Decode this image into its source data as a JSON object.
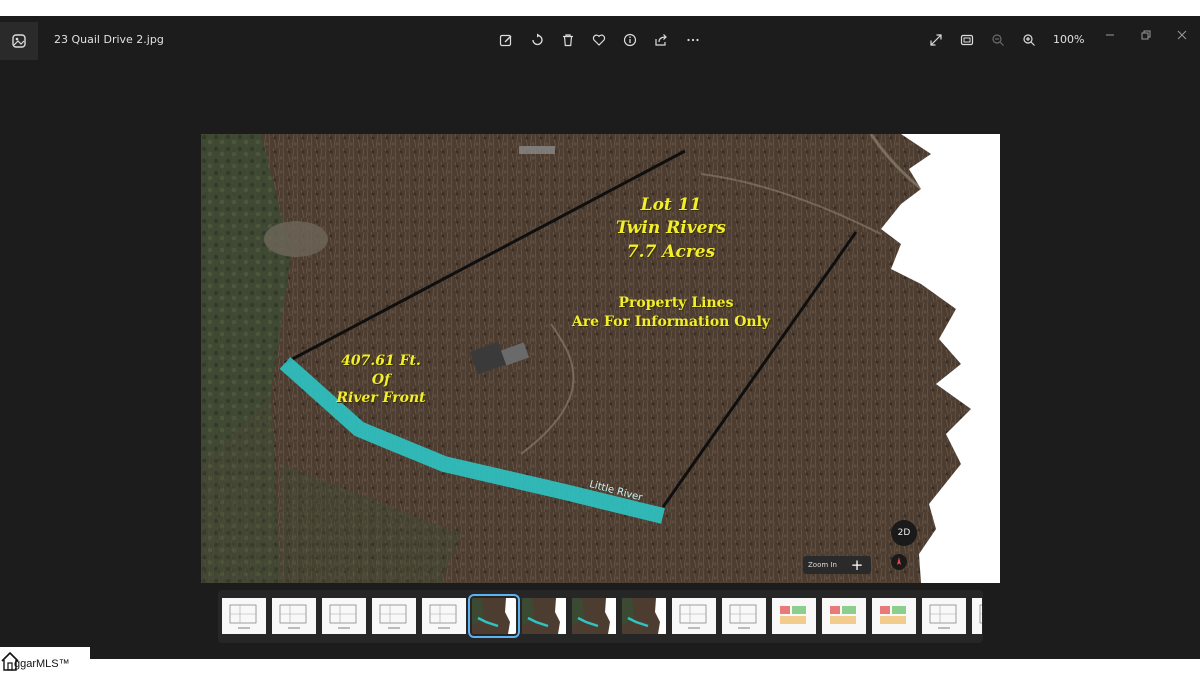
{
  "window": {
    "filename": "23 Quail Drive 2.jpg",
    "zoom_label": "100%"
  },
  "toolbar": {
    "icons": [
      "edit-icon",
      "rotate-icon",
      "delete-icon",
      "favorite-icon",
      "info-icon",
      "share-icon",
      "more-icon"
    ],
    "right_icons": [
      "fullscreen-icon",
      "fit-to-window-icon",
      "zoom-out-icon",
      "zoom-in-icon"
    ]
  },
  "photo": {
    "lot_title": "Lot 11",
    "lot_subdivision": "Twin Rivers",
    "lot_acres": "7.7 Acres",
    "disclaimer_line1": "Property Lines",
    "disclaimer_line2": "Are For Information Only",
    "river_front_line1": "407.61 Ft.",
    "river_front_line2": "Of",
    "river_front_line3": "River Front",
    "river_label": "Little River",
    "map_2d_button": "2D",
    "map_zoom_label": "Zoom In",
    "map_zoom_plus": "+",
    "overlay_text_color": "#f2ee2e",
    "river_color": "#2ec4c4"
  },
  "filmstrip": {
    "thumbnails": [
      {
        "kind": "plan"
      },
      {
        "kind": "plan"
      },
      {
        "kind": "plan"
      },
      {
        "kind": "plan"
      },
      {
        "kind": "plan"
      },
      {
        "kind": "aerial",
        "selected": true
      },
      {
        "kind": "aerial"
      },
      {
        "kind": "aerial"
      },
      {
        "kind": "aerial"
      },
      {
        "kind": "plan"
      },
      {
        "kind": "plan"
      },
      {
        "kind": "plan-color"
      },
      {
        "kind": "plan-color"
      },
      {
        "kind": "plan-color"
      },
      {
        "kind": "plan"
      },
      {
        "kind": "plan"
      }
    ],
    "selected_index": 5
  },
  "watermark": {
    "text": "ggarMLS™"
  }
}
